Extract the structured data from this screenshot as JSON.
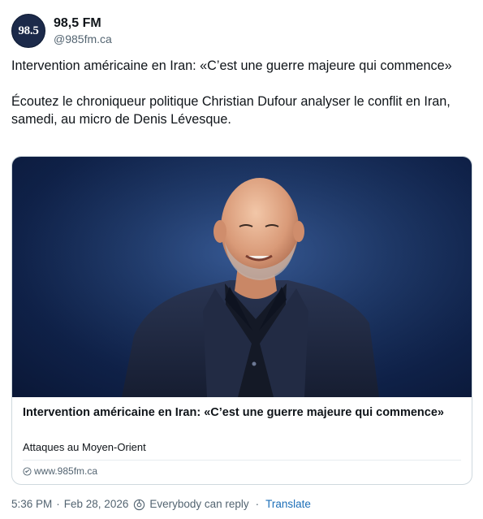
{
  "account": {
    "avatar_text": "98.5",
    "display_name": "98,5 FM",
    "handle": "@985fm.ca"
  },
  "post": {
    "paragraph1": "Intervention américaine en Iran: «C’est une guerre majeure qui commence»",
    "paragraph2": "Écoutez le chroniqueur politique Christian Dufour analyser le conflit en Iran, samedi, au micro de Denis Lévesque."
  },
  "link_card": {
    "title": "Intervention américaine en Iran: «C’est une guerre majeure qui commence»",
    "subtitle": "Attaques au Moyen-Orient",
    "domain": "www.985fm.ca",
    "image_description_icon": "portrait-photo"
  },
  "footer": {
    "time": "5:36 PM",
    "separator": "·",
    "date": "Feb 28, 2026",
    "reply_setting": "Everybody can reply",
    "separator2": "·",
    "translate_label": "Translate"
  },
  "colors": {
    "text_primary": "#0f1419",
    "text_secondary": "#536471",
    "link": "#1d6fb8",
    "card_border": "#cfd9de",
    "avatar_bg": "#1c2a4a"
  }
}
